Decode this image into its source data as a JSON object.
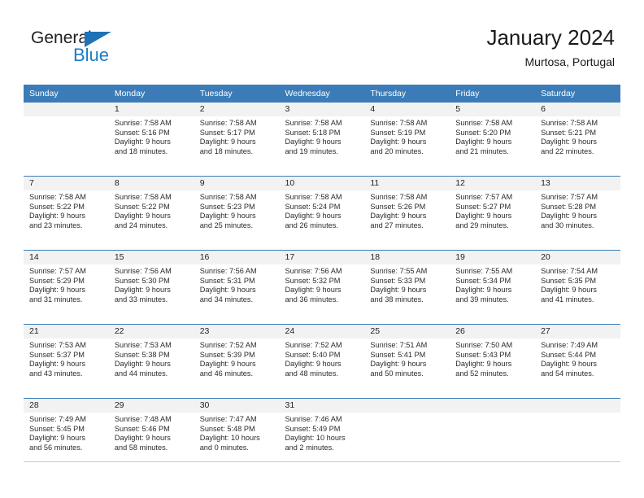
{
  "brand": {
    "name_part1": "General",
    "name_part2": "Blue",
    "logo_icon": "blue-triangle-flag",
    "color_dark": "#231f20",
    "color_blue": "#1b7cc4"
  },
  "header": {
    "title": "January 2024",
    "subtitle": "Murtosa, Portugal"
  },
  "calendar": {
    "header_bg": "#3b7cb8",
    "daynum_bg": "#f2f2f2",
    "weekday_headers": [
      "Sunday",
      "Monday",
      "Tuesday",
      "Wednesday",
      "Thursday",
      "Friday",
      "Saturday"
    ],
    "weeks": [
      [
        {
          "day": "",
          "sunrise": "",
          "sunset": "",
          "daylight1": "",
          "daylight2": ""
        },
        {
          "day": "1",
          "sunrise": "Sunrise: 7:58 AM",
          "sunset": "Sunset: 5:16 PM",
          "daylight1": "Daylight: 9 hours",
          "daylight2": "and 18 minutes."
        },
        {
          "day": "2",
          "sunrise": "Sunrise: 7:58 AM",
          "sunset": "Sunset: 5:17 PM",
          "daylight1": "Daylight: 9 hours",
          "daylight2": "and 18 minutes."
        },
        {
          "day": "3",
          "sunrise": "Sunrise: 7:58 AM",
          "sunset": "Sunset: 5:18 PM",
          "daylight1": "Daylight: 9 hours",
          "daylight2": "and 19 minutes."
        },
        {
          "day": "4",
          "sunrise": "Sunrise: 7:58 AM",
          "sunset": "Sunset: 5:19 PM",
          "daylight1": "Daylight: 9 hours",
          "daylight2": "and 20 minutes."
        },
        {
          "day": "5",
          "sunrise": "Sunrise: 7:58 AM",
          "sunset": "Sunset: 5:20 PM",
          "daylight1": "Daylight: 9 hours",
          "daylight2": "and 21 minutes."
        },
        {
          "day": "6",
          "sunrise": "Sunrise: 7:58 AM",
          "sunset": "Sunset: 5:21 PM",
          "daylight1": "Daylight: 9 hours",
          "daylight2": "and 22 minutes."
        }
      ],
      [
        {
          "day": "7",
          "sunrise": "Sunrise: 7:58 AM",
          "sunset": "Sunset: 5:22 PM",
          "daylight1": "Daylight: 9 hours",
          "daylight2": "and 23 minutes."
        },
        {
          "day": "8",
          "sunrise": "Sunrise: 7:58 AM",
          "sunset": "Sunset: 5:22 PM",
          "daylight1": "Daylight: 9 hours",
          "daylight2": "and 24 minutes."
        },
        {
          "day": "9",
          "sunrise": "Sunrise: 7:58 AM",
          "sunset": "Sunset: 5:23 PM",
          "daylight1": "Daylight: 9 hours",
          "daylight2": "and 25 minutes."
        },
        {
          "day": "10",
          "sunrise": "Sunrise: 7:58 AM",
          "sunset": "Sunset: 5:24 PM",
          "daylight1": "Daylight: 9 hours",
          "daylight2": "and 26 minutes."
        },
        {
          "day": "11",
          "sunrise": "Sunrise: 7:58 AM",
          "sunset": "Sunset: 5:26 PM",
          "daylight1": "Daylight: 9 hours",
          "daylight2": "and 27 minutes."
        },
        {
          "day": "12",
          "sunrise": "Sunrise: 7:57 AM",
          "sunset": "Sunset: 5:27 PM",
          "daylight1": "Daylight: 9 hours",
          "daylight2": "and 29 minutes."
        },
        {
          "day": "13",
          "sunrise": "Sunrise: 7:57 AM",
          "sunset": "Sunset: 5:28 PM",
          "daylight1": "Daylight: 9 hours",
          "daylight2": "and 30 minutes."
        }
      ],
      [
        {
          "day": "14",
          "sunrise": "Sunrise: 7:57 AM",
          "sunset": "Sunset: 5:29 PM",
          "daylight1": "Daylight: 9 hours",
          "daylight2": "and 31 minutes."
        },
        {
          "day": "15",
          "sunrise": "Sunrise: 7:56 AM",
          "sunset": "Sunset: 5:30 PM",
          "daylight1": "Daylight: 9 hours",
          "daylight2": "and 33 minutes."
        },
        {
          "day": "16",
          "sunrise": "Sunrise: 7:56 AM",
          "sunset": "Sunset: 5:31 PM",
          "daylight1": "Daylight: 9 hours",
          "daylight2": "and 34 minutes."
        },
        {
          "day": "17",
          "sunrise": "Sunrise: 7:56 AM",
          "sunset": "Sunset: 5:32 PM",
          "daylight1": "Daylight: 9 hours",
          "daylight2": "and 36 minutes."
        },
        {
          "day": "18",
          "sunrise": "Sunrise: 7:55 AM",
          "sunset": "Sunset: 5:33 PM",
          "daylight1": "Daylight: 9 hours",
          "daylight2": "and 38 minutes."
        },
        {
          "day": "19",
          "sunrise": "Sunrise: 7:55 AM",
          "sunset": "Sunset: 5:34 PM",
          "daylight1": "Daylight: 9 hours",
          "daylight2": "and 39 minutes."
        },
        {
          "day": "20",
          "sunrise": "Sunrise: 7:54 AM",
          "sunset": "Sunset: 5:35 PM",
          "daylight1": "Daylight: 9 hours",
          "daylight2": "and 41 minutes."
        }
      ],
      [
        {
          "day": "21",
          "sunrise": "Sunrise: 7:53 AM",
          "sunset": "Sunset: 5:37 PM",
          "daylight1": "Daylight: 9 hours",
          "daylight2": "and 43 minutes."
        },
        {
          "day": "22",
          "sunrise": "Sunrise: 7:53 AM",
          "sunset": "Sunset: 5:38 PM",
          "daylight1": "Daylight: 9 hours",
          "daylight2": "and 44 minutes."
        },
        {
          "day": "23",
          "sunrise": "Sunrise: 7:52 AM",
          "sunset": "Sunset: 5:39 PM",
          "daylight1": "Daylight: 9 hours",
          "daylight2": "and 46 minutes."
        },
        {
          "day": "24",
          "sunrise": "Sunrise: 7:52 AM",
          "sunset": "Sunset: 5:40 PM",
          "daylight1": "Daylight: 9 hours",
          "daylight2": "and 48 minutes."
        },
        {
          "day": "25",
          "sunrise": "Sunrise: 7:51 AM",
          "sunset": "Sunset: 5:41 PM",
          "daylight1": "Daylight: 9 hours",
          "daylight2": "and 50 minutes."
        },
        {
          "day": "26",
          "sunrise": "Sunrise: 7:50 AM",
          "sunset": "Sunset: 5:43 PM",
          "daylight1": "Daylight: 9 hours",
          "daylight2": "and 52 minutes."
        },
        {
          "day": "27",
          "sunrise": "Sunrise: 7:49 AM",
          "sunset": "Sunset: 5:44 PM",
          "daylight1": "Daylight: 9 hours",
          "daylight2": "and 54 minutes."
        }
      ],
      [
        {
          "day": "28",
          "sunrise": "Sunrise: 7:49 AM",
          "sunset": "Sunset: 5:45 PM",
          "daylight1": "Daylight: 9 hours",
          "daylight2": "and 56 minutes."
        },
        {
          "day": "29",
          "sunrise": "Sunrise: 7:48 AM",
          "sunset": "Sunset: 5:46 PM",
          "daylight1": "Daylight: 9 hours",
          "daylight2": "and 58 minutes."
        },
        {
          "day": "30",
          "sunrise": "Sunrise: 7:47 AM",
          "sunset": "Sunset: 5:48 PM",
          "daylight1": "Daylight: 10 hours",
          "daylight2": "and 0 minutes."
        },
        {
          "day": "31",
          "sunrise": "Sunrise: 7:46 AM",
          "sunset": "Sunset: 5:49 PM",
          "daylight1": "Daylight: 10 hours",
          "daylight2": "and 2 minutes."
        },
        {
          "day": "",
          "sunrise": "",
          "sunset": "",
          "daylight1": "",
          "daylight2": ""
        },
        {
          "day": "",
          "sunrise": "",
          "sunset": "",
          "daylight1": "",
          "daylight2": ""
        },
        {
          "day": "",
          "sunrise": "",
          "sunset": "",
          "daylight1": "",
          "daylight2": ""
        }
      ]
    ]
  }
}
